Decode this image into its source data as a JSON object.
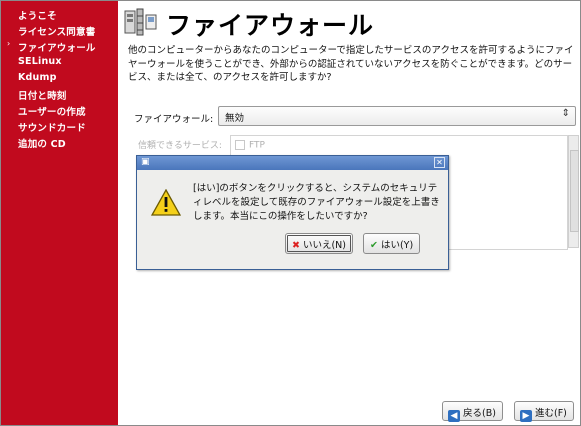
{
  "sidebar": {
    "items": [
      {
        "label": "ようこそ",
        "current": false
      },
      {
        "label": "ライセンス同意書",
        "current": false
      },
      {
        "label": "ファイアウォール",
        "current": true
      },
      {
        "label": "SELinux",
        "current": false
      },
      {
        "label": "Kdump",
        "current": false
      },
      {
        "label": "日付と時刻",
        "current": false
      },
      {
        "label": "ユーザーの作成",
        "current": false
      },
      {
        "label": "サウンドカード",
        "current": false
      },
      {
        "label": "追加の CD",
        "current": false
      }
    ],
    "current_marker": "›"
  },
  "page": {
    "title": "ファイアウォール",
    "description": "他のコンピューターからあなたのコンピューターで指定したサービスのアクセスを許可するようにファイヤーウォールを使うことができ、外部からの認証されていないアクセスを防ぐことができます。どのサービス、または全て、のアクセスを許可しますか?",
    "firewall_label": "ファイアウォール:",
    "firewall_value": "無効",
    "services_label": "信頼できるサービス:",
    "services": [
      {
        "label": "FTP",
        "checked": false
      }
    ]
  },
  "nav": {
    "back_label": "戻る(B)",
    "forward_label": "進む(F)"
  },
  "dialog": {
    "message": "[はい]のボタンをクリックすると、システムのセキュリティレベルを設定して既存のファイアウォール設定を上書きします。本当にこの操作をしたいですか?",
    "no_label": "いいえ(N)",
    "yes_label": "はい(Y)",
    "close_glyph": "✕"
  },
  "colors": {
    "sidebar": "#c10a1e",
    "dialog_titlebar": "#4a76bb"
  }
}
